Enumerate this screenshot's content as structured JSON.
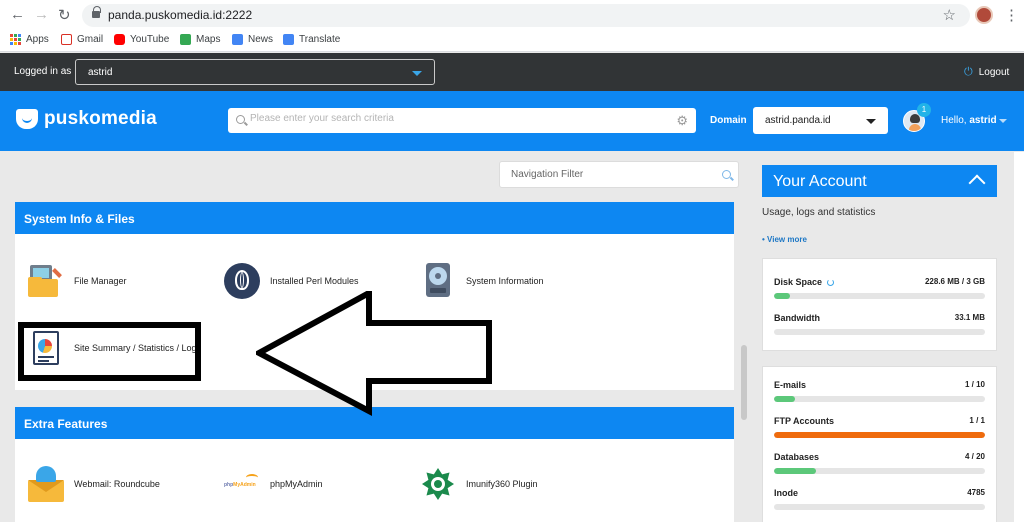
{
  "browser": {
    "url": "panda.puskomedia.id:2222",
    "bookmarks": [
      "Apps",
      "Gmail",
      "YouTube",
      "Maps",
      "News",
      "Translate"
    ]
  },
  "loginbar": {
    "label": "Logged in as",
    "user": "astrid",
    "logout": "Logout"
  },
  "header": {
    "brand": "puskomedia",
    "search_placeholder": "Please enter your search criteria",
    "domain_label": "Domain",
    "domain_value": "astrid.panda.id",
    "notifications": "1",
    "greeting": "Hello,",
    "greeting_user": "astrid"
  },
  "nav_filter_placeholder": "Navigation Filter",
  "sections": [
    {
      "title": "System Info & Files",
      "items": [
        {
          "label": "File Manager",
          "icon": "file-manager-icon"
        },
        {
          "label": "Installed Perl Modules",
          "icon": "perl-onion-icon"
        },
        {
          "label": "System Information",
          "icon": "hard-drive-icon"
        },
        {
          "label": "Site Summary / Statistics / Logs",
          "icon": "report-chart-icon"
        }
      ]
    },
    {
      "title": "Extra Features",
      "items": [
        {
          "label": "Webmail: Roundcube",
          "icon": "roundcube-icon"
        },
        {
          "label": "phpMyAdmin",
          "icon": "phpmyadmin-icon"
        },
        {
          "label": "Imunify360 Plugin",
          "icon": "imunify360-icon"
        }
      ]
    }
  ],
  "account": {
    "title": "Your Account",
    "subtitle": "Usage, logs and statistics",
    "view_more": "• View more",
    "stats_group1": [
      {
        "name": "Disk Space",
        "value": "228.6 MB / 3 GB",
        "fraction": 0.075,
        "color": "#5cc87a"
      },
      {
        "name": "Bandwidth",
        "value": "33.1 MB",
        "fraction": 0.0,
        "color": "#5cc87a"
      }
    ],
    "stats_group2": [
      {
        "name": "E-mails",
        "value": "1 / 10",
        "fraction": 0.1,
        "color": "#5cc87a"
      },
      {
        "name": "FTP Accounts",
        "value": "1 / 1",
        "fraction": 1.0,
        "color": "#ef6b0d"
      },
      {
        "name": "Databases",
        "value": "4 / 20",
        "fraction": 0.2,
        "color": "#5cc87a"
      },
      {
        "name": "Inode",
        "value": "4785",
        "fraction": 0.0,
        "color": "#5cc87a"
      }
    ]
  },
  "colors": {
    "primary": "#0d87f2",
    "topbar": "#313436",
    "warning": "#ef6b0d",
    "success": "#5cc87a"
  }
}
